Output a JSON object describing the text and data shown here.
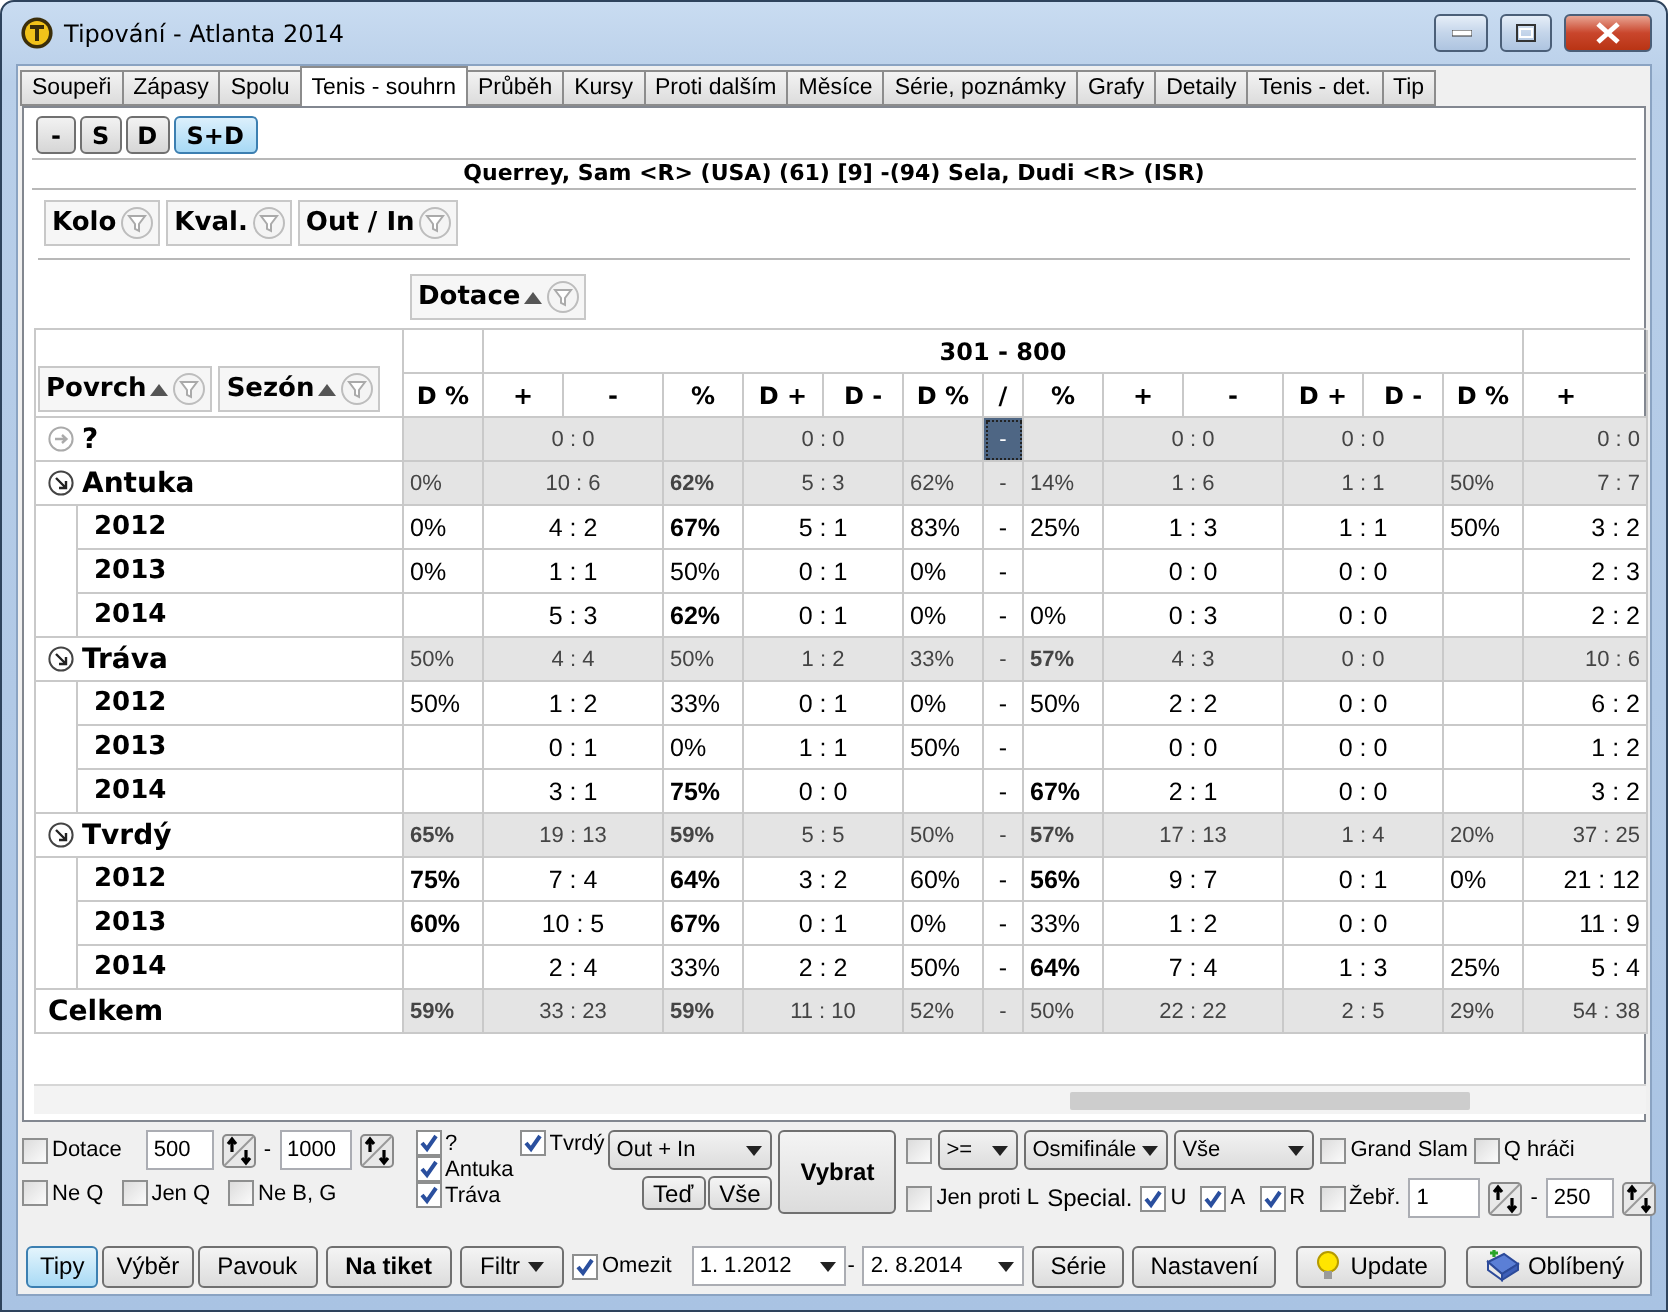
{
  "window": {
    "title": "Tipování - Atlanta 2014"
  },
  "tabs": [
    {
      "label": "Soupeři",
      "selected": false
    },
    {
      "label": "Zápasy",
      "selected": false
    },
    {
      "label": "Spolu",
      "selected": false
    },
    {
      "label": "Tenis - souhrn",
      "selected": true
    },
    {
      "label": "Průběh",
      "selected": false
    },
    {
      "label": "Kursy",
      "selected": false
    },
    {
      "label": "Proti dalším",
      "selected": false
    },
    {
      "label": "Měsíce",
      "selected": false
    },
    {
      "label": "Série, poznámky",
      "selected": false
    },
    {
      "label": "Grafy",
      "selected": false
    },
    {
      "label": "Detaily",
      "selected": false
    },
    {
      "label": "Tenis - det.",
      "selected": false
    },
    {
      "label": "Tip",
      "selected": false
    }
  ],
  "modes": [
    {
      "label": "-",
      "selected": false
    },
    {
      "label": "S",
      "selected": false
    },
    {
      "label": "D",
      "selected": false
    },
    {
      "label": "S+D",
      "selected": true
    }
  ],
  "match": "Querrey, Sam <R> (USA) (61) [9] -(94) Sela, Dudi <R> (ISR)",
  "filter_chips": [
    {
      "label": "Kolo",
      "sorted": false
    },
    {
      "label": "Kval.",
      "sorted": false
    },
    {
      "label": "Out / In",
      "sorted": false
    }
  ],
  "table": {
    "column_chip": {
      "label": "Dotace",
      "sorted": true
    },
    "row_chips": [
      {
        "label": "Povrch",
        "sorted": true
      },
      {
        "label": "Sezón",
        "sorted": true
      }
    ],
    "band": "301 - 800",
    "columns": [
      {
        "labels": [
          "D %"
        ]
      },
      {
        "labels": [
          "+",
          "-"
        ]
      },
      {
        "labels": [
          "%"
        ]
      },
      {
        "labels": [
          "D +",
          "D -"
        ]
      },
      {
        "labels": [
          "D %"
        ]
      },
      {
        "labels": [
          "/"
        ]
      },
      {
        "labels": [
          "%"
        ]
      },
      {
        "labels": [
          "+",
          "-"
        ]
      },
      {
        "labels": [
          "D +",
          "D -"
        ]
      },
      {
        "labels": [
          "D %"
        ]
      },
      {
        "labels": [
          "+"
        ]
      }
    ],
    "rows": [
      {
        "kind": "group",
        "label": "?",
        "expanded": false,
        "cells": [
          null,
          {
            "text": "0 : 0",
            "bold": false
          },
          null,
          {
            "text": "0 : 0",
            "bold": false
          },
          null,
          {
            "text": "-",
            "bold": false,
            "selected": true
          },
          null,
          {
            "text": "0 : 0",
            "bold": false
          },
          {
            "text": "0 : 0",
            "bold": false
          },
          null,
          {
            "text": "0 : 0",
            "bold": false
          }
        ]
      },
      {
        "kind": "group",
        "label": "Antuka",
        "expanded": true,
        "cells": [
          {
            "text": "0%",
            "bold": false
          },
          {
            "text": "10 : 6",
            "bold": false
          },
          {
            "text": "62%",
            "bold": true
          },
          {
            "text": "5 : 3",
            "bold": false
          },
          {
            "text": "62%",
            "bold": false
          },
          {
            "text": "-",
            "bold": false,
            "selected": false
          },
          {
            "text": "14%",
            "bold": false
          },
          {
            "text": "1 : 6",
            "bold": false
          },
          {
            "text": "1 : 1",
            "bold": false
          },
          {
            "text": "50%",
            "bold": false
          },
          {
            "text": "7 : 7",
            "bold": false
          }
        ],
        "children": [
          {
            "label": "2012",
            "cells": [
              {
                "text": "0%",
                "bold": false
              },
              {
                "text": "4 : 2",
                "bold": false
              },
              {
                "text": "67%",
                "bold": true
              },
              {
                "text": "5 : 1",
                "bold": false
              },
              {
                "text": "83%",
                "bold": false
              },
              {
                "text": "-",
                "bold": false,
                "selected": false
              },
              {
                "text": "25%",
                "bold": false
              },
              {
                "text": "1 : 3",
                "bold": false
              },
              {
                "text": "1 : 1",
                "bold": false
              },
              {
                "text": "50%",
                "bold": false
              },
              {
                "text": "3 : 2",
                "bold": false
              }
            ]
          },
          {
            "label": "2013",
            "cells": [
              {
                "text": "0%",
                "bold": false
              },
              {
                "text": "1 : 1",
                "bold": false
              },
              {
                "text": "50%",
                "bold": false
              },
              {
                "text": "0 : 1",
                "bold": false
              },
              {
                "text": "0%",
                "bold": false
              },
              {
                "text": "-",
                "bold": false,
                "selected": false
              },
              null,
              {
                "text": "0 : 0",
                "bold": false
              },
              {
                "text": "0 : 0",
                "bold": false
              },
              null,
              {
                "text": "2 : 3",
                "bold": false
              }
            ]
          },
          {
            "label": "2014",
            "cells": [
              null,
              {
                "text": "5 : 3",
                "bold": false
              },
              {
                "text": "62%",
                "bold": true
              },
              {
                "text": "0 : 1",
                "bold": false
              },
              {
                "text": "0%",
                "bold": false
              },
              {
                "text": "-",
                "bold": false,
                "selected": false
              },
              {
                "text": "0%",
                "bold": false
              },
              {
                "text": "0 : 3",
                "bold": false
              },
              {
                "text": "0 : 0",
                "bold": false
              },
              null,
              {
                "text": "2 : 2",
                "bold": false
              }
            ]
          }
        ]
      },
      {
        "kind": "group",
        "label": "Tráva",
        "expanded": true,
        "cells": [
          {
            "text": "50%",
            "bold": false
          },
          {
            "text": "4 : 4",
            "bold": false
          },
          {
            "text": "50%",
            "bold": false
          },
          {
            "text": "1 : 2",
            "bold": false
          },
          {
            "text": "33%",
            "bold": false
          },
          {
            "text": "-",
            "bold": false,
            "selected": false
          },
          {
            "text": "57%",
            "bold": true
          },
          {
            "text": "4 : 3",
            "bold": false
          },
          {
            "text": "0 : 0",
            "bold": false
          },
          null,
          {
            "text": "10 : 6",
            "bold": false
          }
        ],
        "children": [
          {
            "label": "2012",
            "cells": [
              {
                "text": "50%",
                "bold": false
              },
              {
                "text": "1 : 2",
                "bold": false
              },
              {
                "text": "33%",
                "bold": false
              },
              {
                "text": "0 : 1",
                "bold": false
              },
              {
                "text": "0%",
                "bold": false
              },
              {
                "text": "-",
                "bold": false,
                "selected": false
              },
              {
                "text": "50%",
                "bold": false
              },
              {
                "text": "2 : 2",
                "bold": false
              },
              {
                "text": "0 : 0",
                "bold": false
              },
              null,
              {
                "text": "6 : 2",
                "bold": false
              }
            ]
          },
          {
            "label": "2013",
            "cells": [
              null,
              {
                "text": "0 : 1",
                "bold": false
              },
              {
                "text": "0%",
                "bold": false
              },
              {
                "text": "1 : 1",
                "bold": false
              },
              {
                "text": "50%",
                "bold": false
              },
              {
                "text": "-",
                "bold": false,
                "selected": false
              },
              null,
              {
                "text": "0 : 0",
                "bold": false
              },
              {
                "text": "0 : 0",
                "bold": false
              },
              null,
              {
                "text": "1 : 2",
                "bold": false
              }
            ]
          },
          {
            "label": "2014",
            "cells": [
              null,
              {
                "text": "3 : 1",
                "bold": false
              },
              {
                "text": "75%",
                "bold": true
              },
              {
                "text": "0 : 0",
                "bold": false
              },
              null,
              {
                "text": "-",
                "bold": false,
                "selected": false
              },
              {
                "text": "67%",
                "bold": true
              },
              {
                "text": "2 : 1",
                "bold": false
              },
              {
                "text": "0 : 0",
                "bold": false
              },
              null,
              {
                "text": "3 : 2",
                "bold": false
              }
            ]
          }
        ]
      },
      {
        "kind": "group",
        "label": "Tvrdý",
        "expanded": true,
        "cells": [
          {
            "text": "65%",
            "bold": true
          },
          {
            "text": "19 : 13",
            "bold": false
          },
          {
            "text": "59%",
            "bold": true
          },
          {
            "text": "5 : 5",
            "bold": false
          },
          {
            "text": "50%",
            "bold": false
          },
          {
            "text": "-",
            "bold": false,
            "selected": false
          },
          {
            "text": "57%",
            "bold": true
          },
          {
            "text": "17 : 13",
            "bold": false
          },
          {
            "text": "1 : 4",
            "bold": false
          },
          {
            "text": "20%",
            "bold": false
          },
          {
            "text": "37 : 25",
            "bold": false
          }
        ],
        "children": [
          {
            "label": "2012",
            "cells": [
              {
                "text": "75%",
                "bold": true
              },
              {
                "text": "7 : 4",
                "bold": false
              },
              {
                "text": "64%",
                "bold": true
              },
              {
                "text": "3 : 2",
                "bold": false
              },
              {
                "text": "60%",
                "bold": false
              },
              {
                "text": "-",
                "bold": false,
                "selected": false
              },
              {
                "text": "56%",
                "bold": true
              },
              {
                "text": "9 : 7",
                "bold": false
              },
              {
                "text": "0 : 1",
                "bold": false
              },
              {
                "text": "0%",
                "bold": false
              },
              {
                "text": "21 : 12",
                "bold": false
              }
            ]
          },
          {
            "label": "2013",
            "cells": [
              {
                "text": "60%",
                "bold": true
              },
              {
                "text": "10 : 5",
                "bold": false
              },
              {
                "text": "67%",
                "bold": true
              },
              {
                "text": "0 : 1",
                "bold": false
              },
              {
                "text": "0%",
                "bold": false
              },
              {
                "text": "-",
                "bold": false,
                "selected": false
              },
              {
                "text": "33%",
                "bold": false
              },
              {
                "text": "1 : 2",
                "bold": false
              },
              {
                "text": "0 : 0",
                "bold": false
              },
              null,
              {
                "text": "11 : 9",
                "bold": false
              }
            ]
          },
          {
            "label": "2014",
            "cells": [
              null,
              {
                "text": "2 : 4",
                "bold": false
              },
              {
                "text": "33%",
                "bold": false
              },
              {
                "text": "2 : 2",
                "bold": false
              },
              {
                "text": "50%",
                "bold": false
              },
              {
                "text": "-",
                "bold": false,
                "selected": false
              },
              {
                "text": "64%",
                "bold": true
              },
              {
                "text": "7 : 4",
                "bold": false
              },
              {
                "text": "1 : 3",
                "bold": false
              },
              {
                "text": "25%",
                "bold": false
              },
              {
                "text": "5 : 4",
                "bold": false
              }
            ]
          }
        ]
      },
      {
        "kind": "total",
        "label": "Celkem",
        "cells": [
          {
            "text": "59%",
            "bold": true
          },
          {
            "text": "33 : 23",
            "bold": false
          },
          {
            "text": "59%",
            "bold": true
          },
          {
            "text": "11 : 10",
            "bold": false
          },
          {
            "text": "52%",
            "bold": false
          },
          {
            "text": "-",
            "bold": false,
            "selected": false
          },
          {
            "text": "50%",
            "bold": false
          },
          {
            "text": "22 : 22",
            "bold": false
          },
          {
            "text": "2 : 5",
            "bold": false
          },
          {
            "text": "29%",
            "bold": false
          },
          {
            "text": "54 : 38",
            "bold": false
          }
        ]
      }
    ]
  },
  "filter_panel": {
    "dotace": {
      "label": "Dotace",
      "checked": false,
      "from": "500",
      "separator": "-",
      "to": "1000"
    },
    "exclusions": [
      {
        "label": "Ne Q",
        "checked": false
      },
      {
        "label": "Jen Q",
        "checked": false
      },
      {
        "label": "Ne B, G",
        "checked": false
      }
    ],
    "surfaces": [
      {
        "label": "?",
        "checked": true
      },
      {
        "label": "Antuka",
        "checked": true
      },
      {
        "label": "Tráva",
        "checked": true
      }
    ],
    "hard": {
      "label": "Tvrdý",
      "checked": true
    },
    "out_in": "Out + In",
    "now_button": "Teď",
    "all_button": "Vše",
    "select_button": "Vybrat",
    "round_filter": {
      "checked": false,
      "operator": ">=",
      "round": "Osmifinále",
      "scope": "Vše"
    },
    "grand_slam": {
      "label": "Grand Slam",
      "checked": false
    },
    "q_players": {
      "label": "Q hráči",
      "checked": false
    },
    "only_vs_left": {
      "label": "Jen proti L",
      "checked": false
    },
    "special_label": "Special.",
    "special": [
      {
        "label": "U",
        "checked": true
      },
      {
        "label": "A",
        "checked": true
      },
      {
        "label": "R",
        "checked": true
      }
    ],
    "ranking": {
      "label": "Žebř.",
      "checked": false,
      "from": "1",
      "separator": "-",
      "to": "250"
    }
  },
  "toolbar": {
    "left_buttons": [
      {
        "label": "Tipy",
        "kind": "toggle",
        "selected": true
      },
      {
        "label": "Výběr",
        "kind": "toggle",
        "selected": false
      },
      {
        "label": "Pavouk",
        "kind": "plain",
        "selected": false
      },
      {
        "label": "Na tiket",
        "kind": "strong",
        "selected": false
      },
      {
        "label": "Filtr",
        "kind": "menu",
        "selected": false
      }
    ],
    "limit": {
      "label": "Omezit",
      "checked": true,
      "from": "1. 1.2012",
      "separator": "-",
      "to": "2. 8.2014"
    },
    "right_buttons": [
      {
        "label": "Série",
        "kind": "plain"
      },
      {
        "label": "Nastavení",
        "kind": "plain"
      },
      {
        "label": "Update",
        "kind": "bulb"
      },
      {
        "label": "Oblíbený",
        "kind": "book"
      }
    ]
  }
}
